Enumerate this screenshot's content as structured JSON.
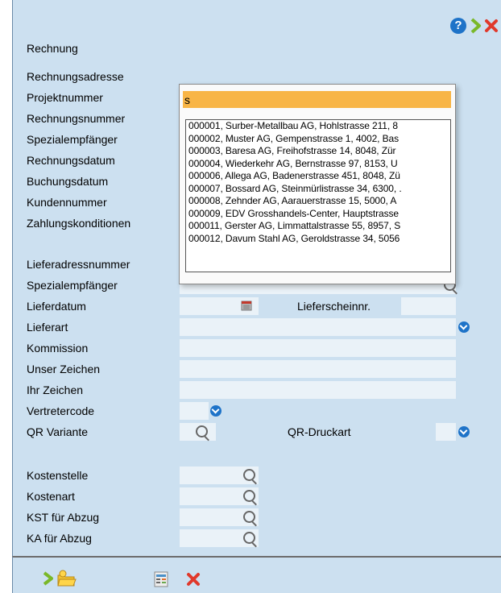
{
  "form": {
    "labels": {
      "rechnung": "Rechnung",
      "rechnungsadresse": "Rechnungsadresse",
      "projektnummer": "Projektnummer",
      "rechnungsnummer": "Rechnungsnummer",
      "spezialempfaenger": "Spezialempfänger",
      "rechnungsdatum": "Rechnungsdatum",
      "buchungsdatum": "Buchungsdatum",
      "kundennummer": "Kundennummer",
      "zahlungskonditionen": "Zahlungskonditionen",
      "lieferadressnummer": "Lieferadressnummer",
      "spezialempfaenger2": "Spezialempfänger",
      "lieferdatum": "Lieferdatum",
      "lieferscheinnr": "Lieferscheinnr.",
      "lieferart": "Lieferart",
      "kommission": "Kommission",
      "unser_zeichen": "Unser Zeichen",
      "ihr_zeichen": "Ihr Zeichen",
      "vertretercode": "Vertretercode",
      "qr_variante": "QR Variante",
      "qr_druckart": "QR-Druckart",
      "kostenstelle": "Kostenstelle",
      "kostenart": "Kostenart",
      "kst_abzug": "KST für Abzug",
      "ka_abzug": "KA für Abzug"
    }
  },
  "popup": {
    "search_value": "s",
    "results": [
      "000001, Surber-Metallbau AG, Hohlstrasse 211, 8",
      "000002, Muster AG, Gempenstrasse 1, 4002, Bas",
      "000003, Baresa  AG, Freihofstrasse 14, 8048, Zür",
      "000004, Wiederkehr AG, Bernstrasse 97, 8153, U",
      "000006, Allega AG, Badenerstrasse 451, 8048, Zü",
      "000007, Bossard AG, Steinmürlistrasse 34, 6300, .",
      "000008, Zehnder AG, Aarauerstrasse 15, 5000, A",
      "000009, EDV Grosshandels-Center, Hauptstrasse",
      "000011, Gerster AG, Limmattalstrasse 55, 8957, S",
      "000012, Davum Stahl AG, Geroldstrasse 34, 5056"
    ]
  },
  "colors": {
    "panel": "#cce0f0",
    "popup_input": "#f8b546",
    "dropdown_circle": "#1e73c8",
    "help_icon": "#1e73c8",
    "close_icon": "#e0392b",
    "next_icon": "#7ab829"
  },
  "icons": {
    "header": [
      "help-icon",
      "next-arrow-icon",
      "close-icon"
    ],
    "footer": [
      "forward-arrow-icon",
      "folder-icon",
      "document-list-icon",
      "close-icon"
    ]
  }
}
